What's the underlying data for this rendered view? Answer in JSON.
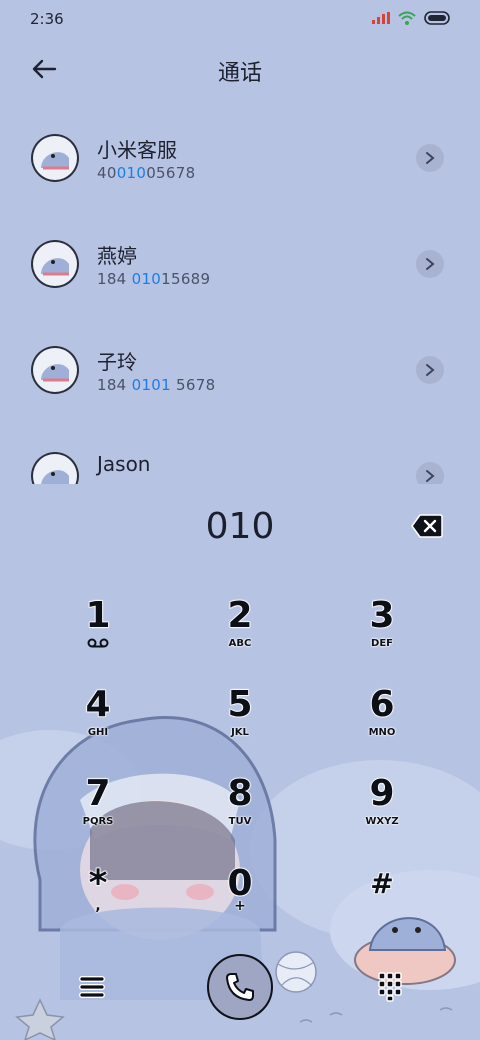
{
  "status_bar": {
    "time": "2:36",
    "icons": [
      "signal-icon",
      "wifi-icon",
      "battery-icon"
    ],
    "signal_color": "#d9423a",
    "wifi_color": "#3aa356"
  },
  "header": {
    "back_icon": "back-arrow-icon",
    "title": "通话"
  },
  "contacts": [
    {
      "name": "小米客服",
      "number_parts": [
        {
          "text": "40",
          "hl": false
        },
        {
          "text": "010",
          "hl": true
        },
        {
          "text": "05678",
          "hl": false
        }
      ]
    },
    {
      "name": "燕婷",
      "number_parts": [
        {
          "text": "184 ",
          "hl": false
        },
        {
          "text": "010",
          "hl": true
        },
        {
          "text": "15689",
          "hl": false
        }
      ]
    },
    {
      "name": "子玲",
      "number_parts": [
        {
          "text": "184 ",
          "hl": false
        },
        {
          "text": "0101",
          "hl": true
        },
        {
          "text": " 5678",
          "hl": false
        }
      ]
    },
    {
      "name": "Jason",
      "number_parts": []
    }
  ],
  "dialer": {
    "input": "010",
    "backspace_icon": "backspace-icon"
  },
  "keypad": [
    {
      "digit": "1",
      "letters": "",
      "sub_icon": "voicemail-icon"
    },
    {
      "digit": "2",
      "letters": "ABC"
    },
    {
      "digit": "3",
      "letters": "DEF"
    },
    {
      "digit": "4",
      "letters": "GHI"
    },
    {
      "digit": "5",
      "letters": "JKL"
    },
    {
      "digit": "6",
      "letters": "MNO"
    },
    {
      "digit": "7",
      "letters": "PQRS"
    },
    {
      "digit": "8",
      "letters": "TUV"
    },
    {
      "digit": "9",
      "letters": "WXYZ"
    },
    {
      "digit": "*",
      "letters": ","
    },
    {
      "digit": "0",
      "letters": "+"
    },
    {
      "digit": "#",
      "letters": ""
    }
  ],
  "bottom_bar": {
    "menu_icon": "menu-icon",
    "call_icon": "phone-icon",
    "dialpad_icon": "dialpad-icon"
  },
  "colors": {
    "background": "#b7c3e3",
    "highlight": "#1c7de6",
    "text": "#1e2230"
  }
}
